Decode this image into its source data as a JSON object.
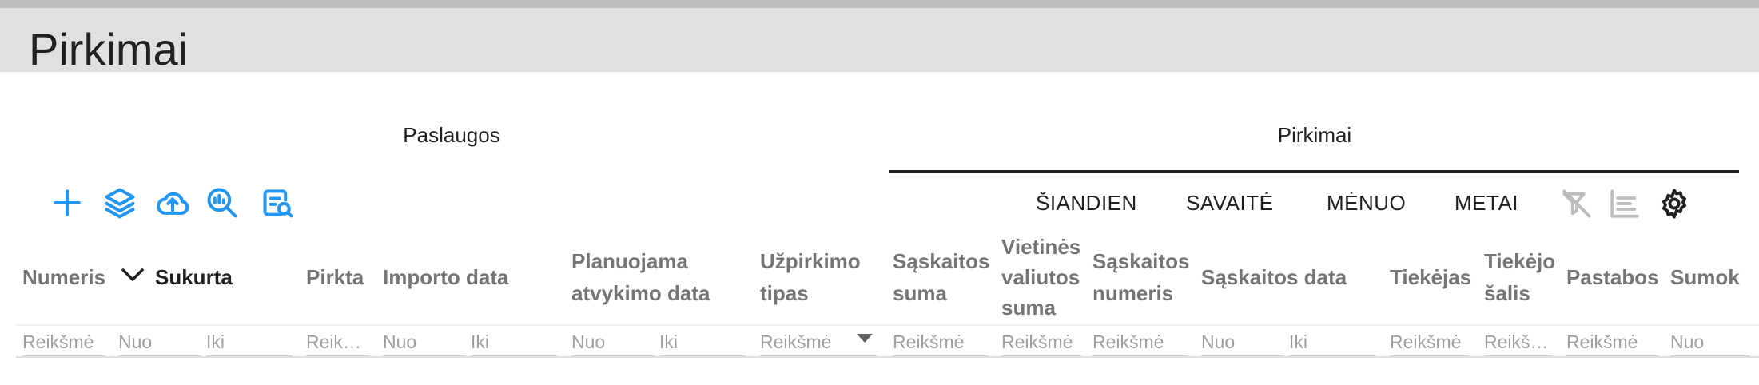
{
  "page": {
    "title": "Pirkimai"
  },
  "tabs": {
    "services": "Paslaugos",
    "purchases": "Pirkimai"
  },
  "toolbar": {
    "icons": [
      "add-icon",
      "layers-icon",
      "cloud-upload-icon",
      "search-analytics-icon",
      "document-search-icon"
    ]
  },
  "periods": {
    "today": "ŠIANDIEN",
    "week": "SAVAITĖ",
    "month": "MĖNUO",
    "year": "METAI"
  },
  "right_icons": [
    "filter-off-icon",
    "list-icon",
    "settings-icon"
  ],
  "columns": {
    "numeris": "Numeris",
    "sukurta": "Sukurta",
    "pirkta": "Pirkta",
    "importo_data": "Importo data",
    "planuojama_1": "Planuojama",
    "planuojama_2": "atvykimo data",
    "uzpirkimo_1": "Užpirkimo",
    "uzpirkimo_2": "tipas",
    "saskaitos_suma_1": "Sąskaitos",
    "saskaitos_suma_2": "suma",
    "vietines_1": "Vietinės",
    "vietines_2": "valiutos",
    "vietines_3": "suma",
    "saskaitos_numeris_1": "Sąskaitos",
    "saskaitos_numeris_2": "numeris",
    "saskaitos_data": "Sąskaitos data",
    "tiekejas": "Tiekėjas",
    "tiekejo_salis_1": "Tiekėjo",
    "tiekejo_salis_2": "šalis",
    "pastabos": "Pastabos",
    "sumok": "Sumok"
  },
  "filters": {
    "numeris": "Reikšmė",
    "sukurta_from": "Nuo",
    "sukurta_to": "Iki",
    "pirkta": "Reikšmė",
    "importo_from": "Nuo",
    "importo_to": "Iki",
    "planuojama_from": "Nuo",
    "planuojama_to": "Iki",
    "uzpirkimo": "Reikšmė",
    "saskaitos_suma": "Reikšmė",
    "vietines": "Reikšmė",
    "saskaitos_numeris": "Reikšmė",
    "saskaitos_data_from": "Nuo",
    "saskaitos_data_to": "Iki",
    "tiekejas": "Reikšmė",
    "tiekejo_salis": "Reikšmė",
    "pastabos": "Reikšmė",
    "sumok": "Nuo"
  },
  "colors": {
    "accent": "#2196f3",
    "header_bg": "#e0e0e0",
    "strip": "#bdbdbd"
  }
}
